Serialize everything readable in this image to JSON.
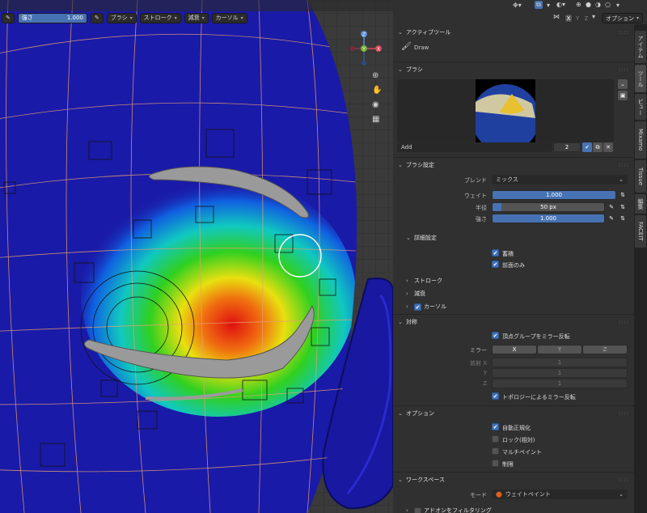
{
  "viewport": {
    "header": {
      "strength_label": "強さ",
      "strength_value": "1.000",
      "menus": [
        "ブラシ",
        "ストローク",
        "減衰",
        "カーソル"
      ]
    },
    "gizmo_axes": {
      "z": "Z",
      "y": "Y",
      "x": "X"
    }
  },
  "editor_header": {
    "axis_buttons": [
      "X",
      "Y",
      "Z"
    ],
    "options_label": "オプション"
  },
  "side_tabs": [
    "アイテム",
    "ツール",
    "ビュー",
    "Mixamo",
    "Tissue",
    "編集",
    "FACEIT"
  ],
  "panel": {
    "active_tool": {
      "title": "アクティブツール",
      "tool_name": "Draw"
    },
    "brush": {
      "title": "ブラシ",
      "name": "Add",
      "users": "2"
    },
    "brush_settings": {
      "title": "ブラシ設定",
      "blend_label": "ブレンド",
      "blend_value": "ミックス",
      "weight_label": "ウェイト",
      "weight_value": "1.000",
      "radius_label": "半径",
      "radius_value": "50 px",
      "strength_label": "強さ",
      "strength_value": "1.000",
      "advanced": {
        "title": "詳細設定",
        "accumulate_label": "蓄積",
        "accumulate": true,
        "front_faces_label": "前面のみ",
        "front_faces": true
      },
      "stroke_title": "ストローク",
      "falloff_title": "減衰",
      "cursor_title": "カーソル"
    },
    "symmetry": {
      "title": "対称",
      "vgroup_mirror_label": "頂点グループをミラー反転",
      "vgroup_mirror": true,
      "mirror_label": "ミラー",
      "mirror_axes": [
        "X",
        "Y",
        "Z"
      ],
      "radial_x_label": "放射 X",
      "radial_y_label": "Y",
      "radial_z_label": "Z",
      "radial_values": [
        "1",
        "1",
        "1"
      ],
      "topology_mirror_label": "トポロジーによるミラー反転",
      "topology_mirror": true
    },
    "options": {
      "title": "オプション",
      "auto_normalize_label": "自動正規化",
      "auto_normalize": true,
      "lock_relative_label": "ロック(相対)",
      "lock_relative": false,
      "multi_paint_label": "マルチペイント",
      "multi_paint": false,
      "restrict_label": "制限",
      "restrict": false
    },
    "workspace": {
      "title": "ワークスペース",
      "mode_label": "モード",
      "mode_value": "ウェイトペイント",
      "filter_addons_label": "アドオンをフィルタリング"
    }
  },
  "colors": {
    "panel_bg": "#303030",
    "accent_blue": "#4772b3",
    "wire_orange": "#e8a070",
    "mesh_blue": "#1a1aa8"
  }
}
